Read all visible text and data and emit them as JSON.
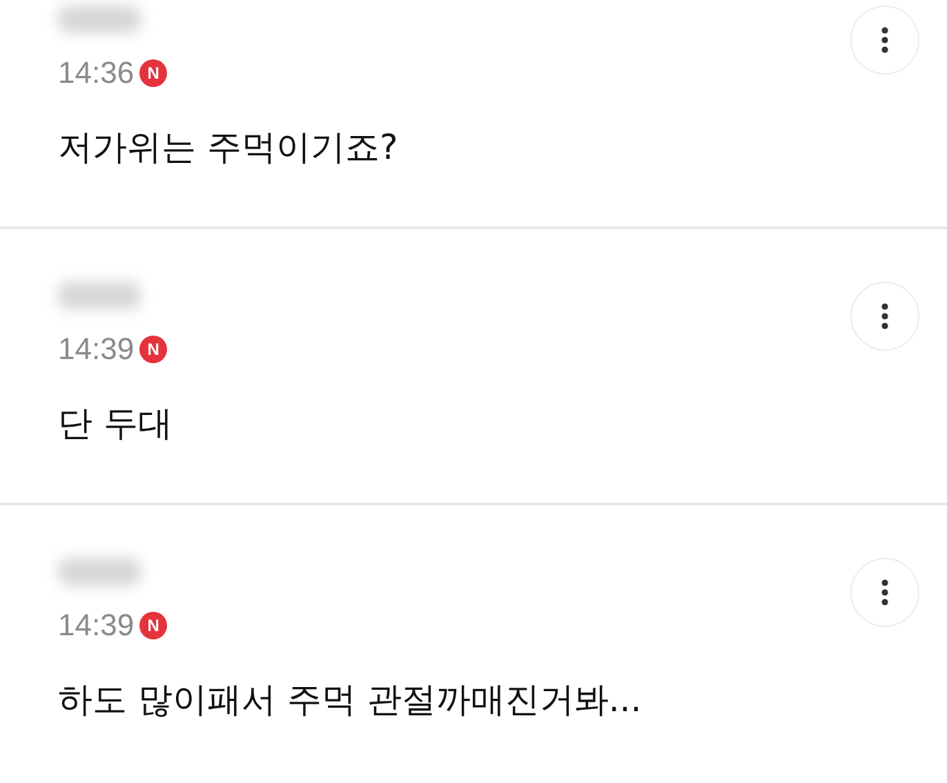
{
  "comments": [
    {
      "time": "14:36",
      "badge": "N",
      "text": "저가위는 주먹이기죠?"
    },
    {
      "time": "14:39",
      "badge": "N",
      "text": "단 두대"
    },
    {
      "time": "14:39",
      "badge": "N",
      "text": "하도 많이패서 주먹 관절까매진거봐..."
    }
  ]
}
